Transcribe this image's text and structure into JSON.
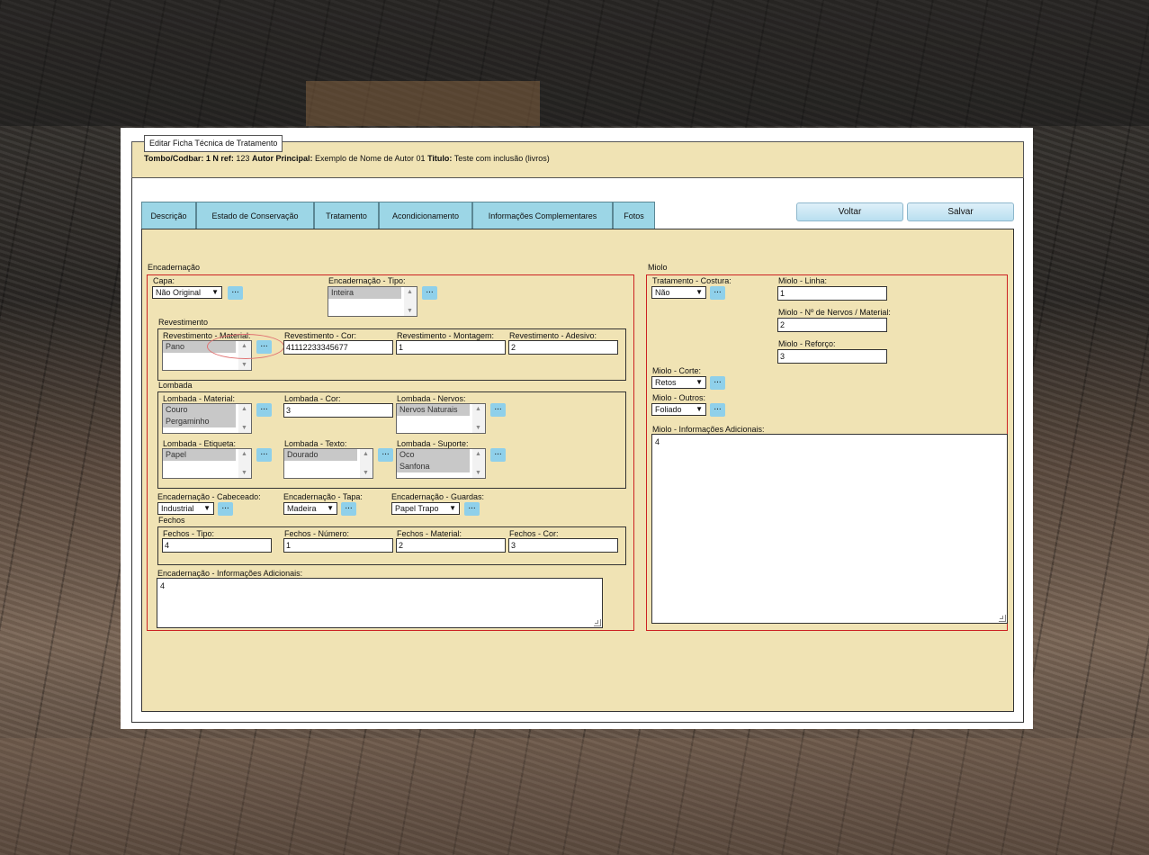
{
  "window": {
    "legend": "Editar Ficha Técnica de Tratamento"
  },
  "info": {
    "tombo_label": "Tombo/Codbar:",
    "tombo_value": "1",
    "nref_label": "N ref:",
    "nref_value": "123",
    "autor_label": "Autor Principal:",
    "autor_value": "Exemplo de Nome de Autor 01",
    "titulo_label": "Titulo:",
    "titulo_value": "Teste com inclusão (livros)"
  },
  "tabs": [
    "Descrição",
    "Estado de Conservação",
    "Tratamento",
    "Acondicionamento",
    "Informações Complementares",
    "Fotos"
  ],
  "buttons": {
    "voltar": "Voltar",
    "salvar": "Salvar",
    "dots": "..."
  },
  "encadernacao": {
    "section": "Encadernação",
    "capa_label": "Capa:",
    "capa_value": "Não Original",
    "tipo_label": "Encadernação - Tipo:",
    "tipo_options": [
      "Inteira"
    ],
    "revestimento": {
      "title": "Revestimento",
      "material_label": "Revestimento - Material:",
      "material_options": [
        "Pano"
      ],
      "cor_label": "Revestimento - Cor:",
      "cor_value": "41112233345677",
      "montagem_label": "Revestimento - Montagem:",
      "montagem_value": "1",
      "adesivo_label": "Revestimento - Adesivo:",
      "adesivo_value": "2"
    },
    "lombada": {
      "title": "Lombada",
      "material_label": "Lombada - Material:",
      "material_options": [
        "Couro",
        "Pergaminho"
      ],
      "cor_label": "Lombada - Cor:",
      "cor_value": "3",
      "nervos_label": "Lombada - Nervos:",
      "nervos_options": [
        "Nervos Naturais"
      ],
      "etiqueta_label": "Lombada - Etiqueta:",
      "etiqueta_options": [
        "Papel"
      ],
      "texto_label": "Lombada - Texto:",
      "texto_options": [
        "Dourado"
      ],
      "suporte_label": "Lombada - Suporte:",
      "suporte_options": [
        "Oco",
        "Sanfona"
      ]
    },
    "cabeceado_label": "Encadernação - Cabeceado:",
    "cabeceado_value": "Industrial",
    "tapa_label": "Encadernação - Tapa:",
    "tapa_value": "Madeira",
    "guardas_label": "Encadernação - Guardas:",
    "guardas_value": "Papel Trapo",
    "fechos": {
      "title": "Fechos",
      "tipo_label": "Fechos - Tipo:",
      "tipo_value": "4",
      "numero_label": "Fechos - Número:",
      "numero_value": "1",
      "material_label": "Fechos - Material:",
      "material_value": "2",
      "cor_label": "Fechos - Cor:",
      "cor_value": "3"
    },
    "info_label": "Encadernação - Informações Adicionais:",
    "info_value": "4"
  },
  "miolo": {
    "section": "Miolo",
    "costura_label": "Tratamento - Costura:",
    "costura_value": "Não",
    "linha_label": "Miolo - Linha:",
    "linha_value": "1",
    "nervos_label": "Miolo - Nº de Nervos / Material:",
    "nervos_value": "2",
    "reforco_label": "Miolo - Reforço:",
    "reforco_value": "3",
    "corte_label": "Miolo - Corte:",
    "corte_value": "Retos",
    "outros_label": "Miolo - Outros:",
    "outros_value": "Foliado",
    "info_label": "Miolo - Informações Adicionais:",
    "info_value": "4"
  }
}
